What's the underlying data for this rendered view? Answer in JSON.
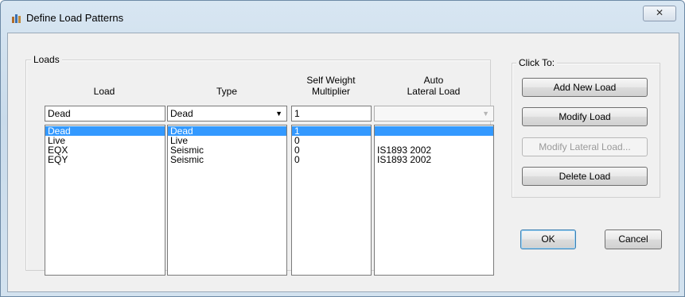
{
  "window": {
    "title": "Define Load Patterns",
    "close_glyph": "✕"
  },
  "loads_group": {
    "legend": "Loads",
    "headers": {
      "load": "Load",
      "type": "Type",
      "self_weight": [
        "Self Weight",
        "Multiplier"
      ],
      "auto_lateral": [
        "Auto",
        "Lateral Load"
      ]
    },
    "inputs": {
      "load_name": "Dead",
      "type": "Dead",
      "self_weight": "1",
      "auto_lateral": ""
    },
    "rows": [
      {
        "load": "Dead",
        "type": "Dead",
        "self_weight": "1",
        "auto_lateral": "",
        "selected": true
      },
      {
        "load": "Live",
        "type": "Live",
        "self_weight": "0",
        "auto_lateral": "",
        "selected": false
      },
      {
        "load": "EQX",
        "type": "Seismic",
        "self_weight": "0",
        "auto_lateral": "IS1893 2002",
        "selected": false
      },
      {
        "load": "EQY",
        "type": "Seismic",
        "self_weight": "0",
        "auto_lateral": "IS1893 2002",
        "selected": false
      }
    ]
  },
  "click_to_group": {
    "legend": "Click To:",
    "buttons": {
      "add_new": "Add New Load",
      "modify": "Modify Load",
      "modify_lateral": "Modify Lateral Load...",
      "delete": "Delete Load"
    }
  },
  "footer": {
    "ok": "OK",
    "cancel": "Cancel"
  },
  "colors": {
    "selection": "#3399ff",
    "dialog_bg": "#f0f0f0"
  }
}
